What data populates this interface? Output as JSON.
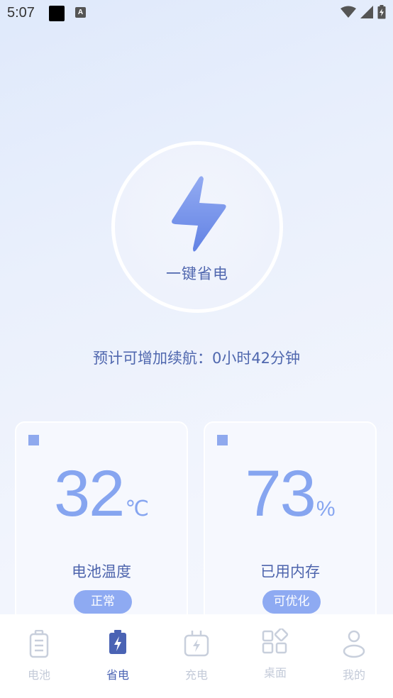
{
  "status_bar": {
    "time": "5:07",
    "accessibility_icon_letter": "A",
    "icons": [
      "wifi-icon",
      "cell-signal-icon",
      "battery-charging-icon"
    ]
  },
  "power_save": {
    "button_label": "一键省电",
    "icon": "lightning-bolt-icon",
    "estimate_text": "预计可增加续航：0小时42分钟"
  },
  "cards": [
    {
      "value": "32",
      "unit": "℃",
      "title": "电池温度",
      "badge": "正常"
    },
    {
      "value": "73",
      "unit": "%",
      "title": "已用内存",
      "badge": "可优化"
    }
  ],
  "tab_bar": {
    "tabs": [
      {
        "label": "电池",
        "icon": "battery-icon",
        "active": false
      },
      {
        "label": "省电",
        "icon": "battery-bolt-icon",
        "active": true
      },
      {
        "label": "充电",
        "icon": "charger-icon",
        "active": false
      },
      {
        "label": "桌面",
        "icon": "apps-grid-icon",
        "active": false
      },
      {
        "label": "我的",
        "icon": "user-icon",
        "active": false
      }
    ]
  },
  "colors": {
    "accent": "#86a5f0",
    "text_primary": "#4e65ad",
    "badge_bg": "#8eaaf2",
    "tab_inactive": "#c3cad8"
  }
}
